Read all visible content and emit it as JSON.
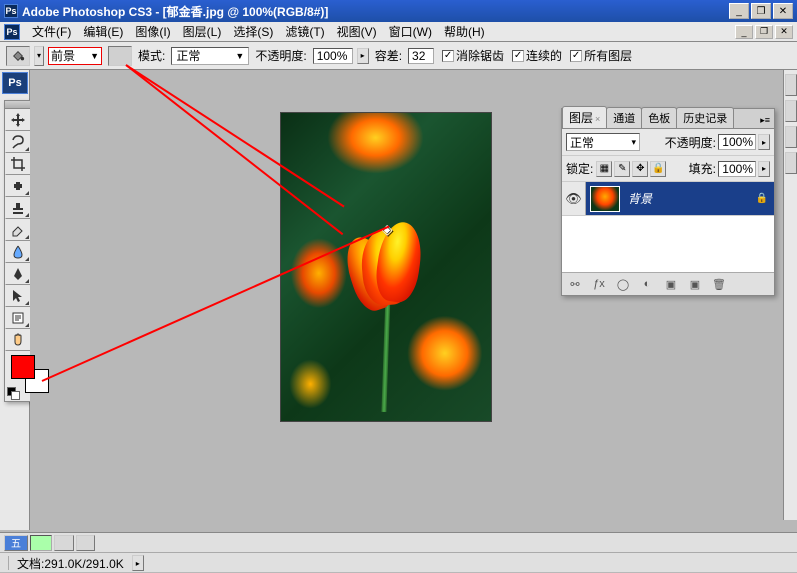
{
  "titlebar": {
    "app": "Adobe Photoshop CS3",
    "doc": "[郁金香.jpg @ 100%(RGB/8#)]"
  },
  "menu": {
    "items": [
      "文件(F)",
      "编辑(E)",
      "图像(I)",
      "图层(L)",
      "选择(S)",
      "滤镜(T)",
      "视图(V)",
      "窗口(W)",
      "帮助(H)"
    ]
  },
  "options": {
    "fill_source": "前景",
    "mode_label": "模式:",
    "mode_value": "正常",
    "opacity_label": "不透明度:",
    "opacity_value": "100%",
    "tolerance_label": "容差:",
    "tolerance_value": "32",
    "cb_antialias": "消除锯齿",
    "cb_contiguous": "连续的",
    "cb_alllayers": "所有图层"
  },
  "layers_panel": {
    "tabs": [
      "图层",
      "通道",
      "色板",
      "历史记录"
    ],
    "blend_mode": "正常",
    "opacity_label": "不透明度:",
    "opacity_value": "100%",
    "lock_label": "锁定:",
    "fill_label": "填充:",
    "fill_value": "100%",
    "layer_name": "背景"
  },
  "status": {
    "doc_label": "文档:",
    "doc_size": "291.0K/291.0K"
  },
  "colors": {
    "foreground": "#ff0000",
    "background": "#ffffff"
  }
}
